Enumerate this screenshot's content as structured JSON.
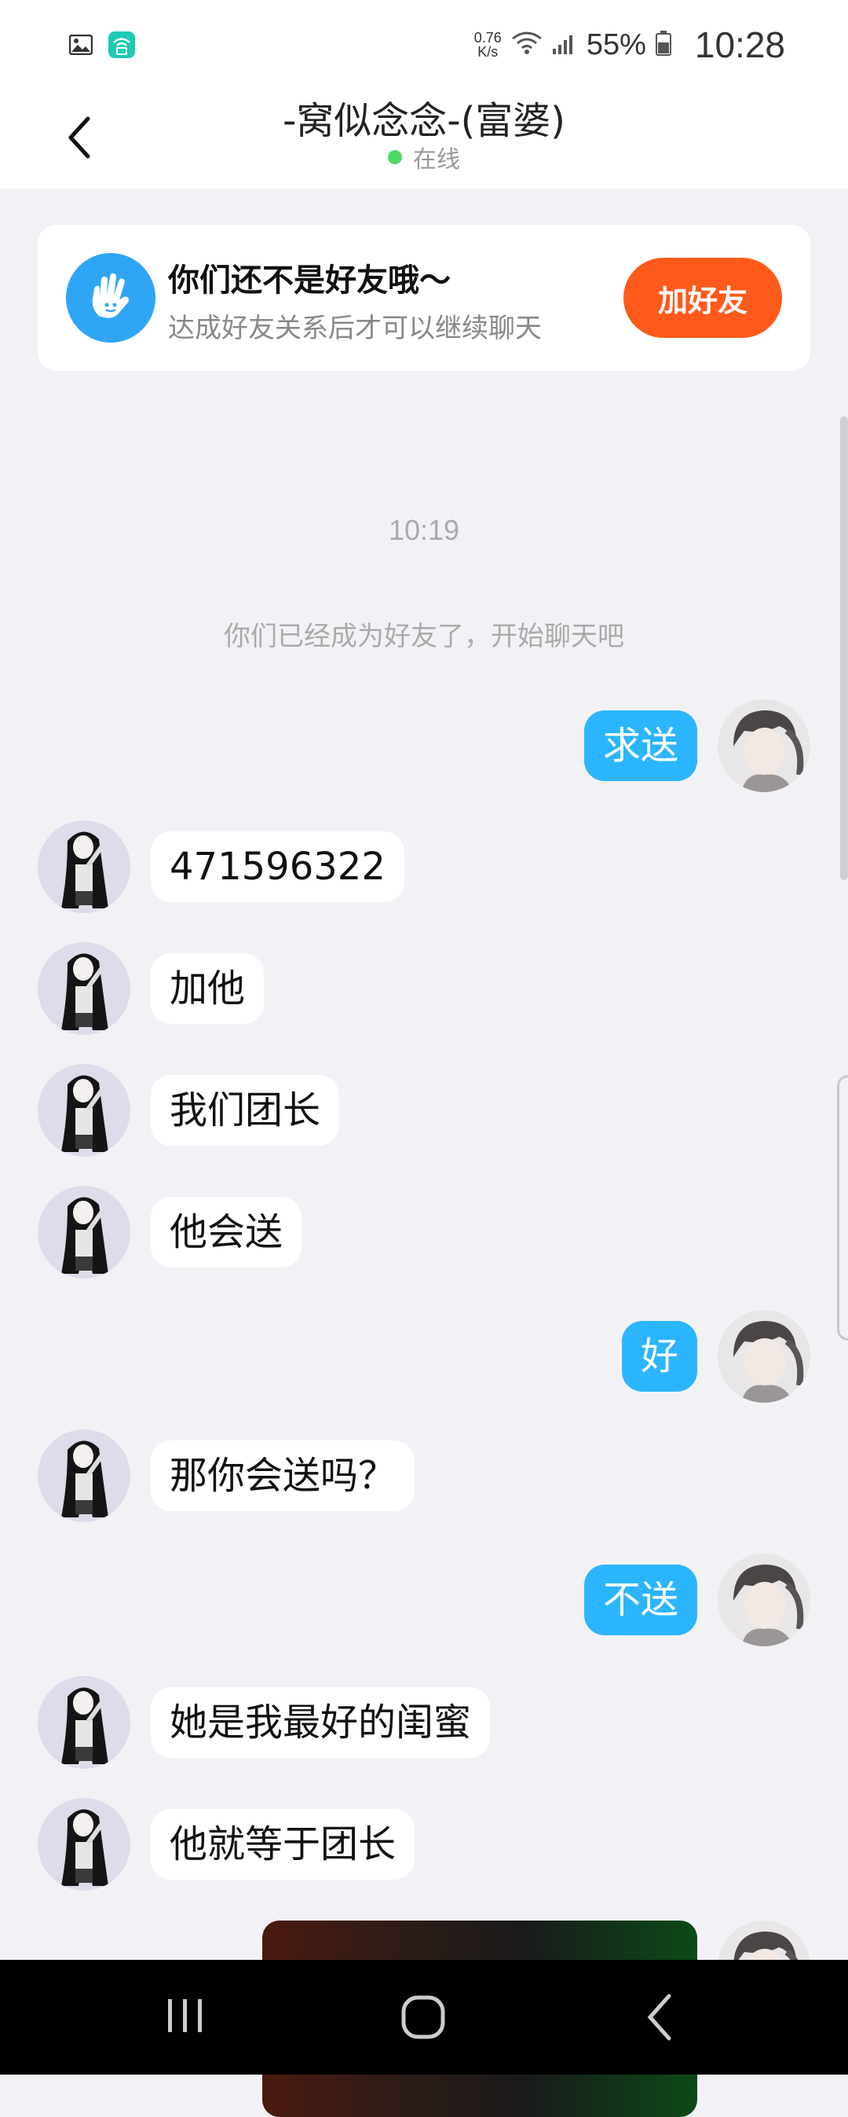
{
  "status_bar": {
    "net_speed_top": "0.76",
    "net_speed_bottom": "K/s",
    "battery": "55%",
    "time": "10:28",
    "icons": [
      "gallery-icon",
      "wifi-app-icon",
      "wifi-icon",
      "signal-icon",
      "battery-icon"
    ]
  },
  "header": {
    "title": "-窝似念念-(富婆)",
    "status": "在线",
    "status_color": "#4cd964"
  },
  "friend_card": {
    "title": "你们还不是好友哦～",
    "subtitle": "达成好友关系后才可以继续聊天",
    "button": "加好友",
    "button_color": "#ff5a1a",
    "icon_color": "#2fa6f5"
  },
  "chat": {
    "timestamp": "10:19",
    "system_message": "你们已经成为好友了，开始聊天吧",
    "messages": [
      {
        "side": "right",
        "text": "求送"
      },
      {
        "side": "left",
        "text": "471596322"
      },
      {
        "side": "left",
        "text": "加他"
      },
      {
        "side": "left",
        "text": "我们团长"
      },
      {
        "side": "left",
        "text": "他会送"
      },
      {
        "side": "right",
        "text": "好"
      },
      {
        "side": "left",
        "text": "那你会送吗？"
      },
      {
        "side": "right",
        "text": "不送"
      },
      {
        "side": "left",
        "text": "她是我最好的闺蜜"
      },
      {
        "side": "left",
        "text": "他就等于团长"
      }
    ],
    "outgoing_bubble_color": "#2cb5ff",
    "incoming_bubble_color": "#ffffff"
  },
  "nav_bar": {
    "buttons": [
      "recent-apps-icon",
      "home-icon",
      "back-icon"
    ]
  }
}
